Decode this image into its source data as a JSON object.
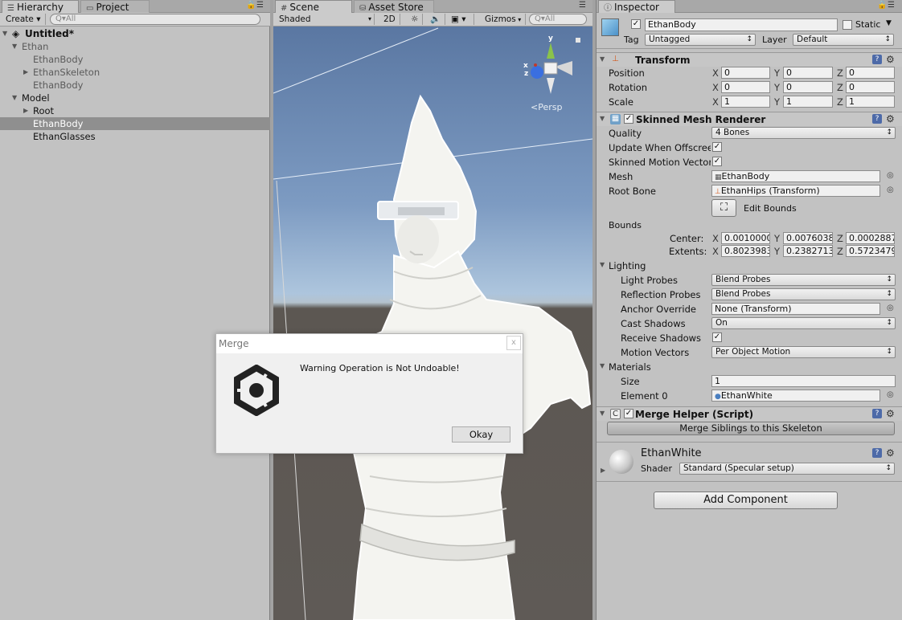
{
  "hierarchy": {
    "tab_label": "Hierarchy",
    "project_tab_label": "Project",
    "create_label": "Create ▾",
    "search_placeholder": "Q▾All",
    "scene_name": "Untitled*",
    "items": [
      {
        "label": "Ethan"
      },
      {
        "label": "EthanBody"
      },
      {
        "label": "EthanSkeleton"
      },
      {
        "label": "EthanBody"
      },
      {
        "label": "Model"
      },
      {
        "label": "Root"
      },
      {
        "label": "EthanBody"
      },
      {
        "label": "EthanGlasses"
      }
    ]
  },
  "scene": {
    "tab_label": "Scene",
    "asset_store_tab_label": "Asset Store",
    "shading_mode": "Shaded",
    "mode_2d": "2D",
    "gizmos_label": "Gizmos",
    "search_placeholder": "Q▾All",
    "persp_label": "<Persp",
    "gizmo_y": "y",
    "gizmo_x": "x",
    "gizmo_z": "z"
  },
  "inspector": {
    "tab_label": "Inspector",
    "object_name": "EthanBody",
    "static_label": "Static",
    "tag_label": "Tag",
    "tag_value": "Untagged",
    "layer_label": "Layer",
    "layer_value": "Default",
    "transform": {
      "title": "Transform",
      "position_label": "Position",
      "rotation_label": "Rotation",
      "scale_label": "Scale",
      "axis_x": "X",
      "axis_y": "Y",
      "axis_z": "Z",
      "position": [
        "0",
        "0",
        "0"
      ],
      "rotation": [
        "0",
        "0",
        "0"
      ],
      "scale": [
        "1",
        "1",
        "1"
      ]
    },
    "smr": {
      "title": "Skinned Mesh Renderer",
      "quality_label": "Quality",
      "quality_value": "4 Bones",
      "update_label": "Update When Offscree",
      "skinned_motion_label": "Skinned Motion Vector",
      "mesh_label": "Mesh",
      "mesh_value": "EthanBody",
      "root_bone_label": "Root Bone",
      "root_bone_value": "EthanHips (Transform)",
      "edit_bounds_label": "Edit Bounds",
      "bounds_label": "Bounds",
      "center_label": "Center:",
      "extents_label": "Extents:",
      "center": [
        "0.0010000",
        "0.0076038",
        "0.0002887"
      ],
      "extents": [
        "0.8023983",
        "0.2382713",
        "0.5723479"
      ],
      "lighting_label": "Lighting",
      "light_probes_label": "Light Probes",
      "light_probes_value": "Blend Probes",
      "reflection_probes_label": "Reflection Probes",
      "reflection_probes_value": "Blend Probes",
      "anchor_override_label": "Anchor Override",
      "anchor_override_value": "None (Transform)",
      "cast_shadows_label": "Cast Shadows",
      "cast_shadows_value": "On",
      "receive_shadows_label": "Receive Shadows",
      "motion_vectors_label": "Motion Vectors",
      "motion_vectors_value": "Per Object Motion",
      "materials_label": "Materials",
      "size_label": "Size",
      "size_value": "1",
      "element0_label": "Element 0",
      "element0_value": "EthanWhite"
    },
    "merge_helper": {
      "title": "Merge Helper (Script)",
      "button_label": "Merge Siblings to this Skeleton"
    },
    "material": {
      "name": "EthanWhite",
      "shader_label": "Shader",
      "shader_value": "Standard (Specular setup)"
    },
    "add_component_label": "Add Component"
  },
  "dialog": {
    "title": "Merge",
    "message": "Warning Operation is Not Undoable!",
    "ok_label": "Okay",
    "close_glyph": "x"
  },
  "colors": {
    "selection": "#8f8f8f",
    "panel": "#c2c2c2",
    "help_icon": "#4d6aa8"
  }
}
